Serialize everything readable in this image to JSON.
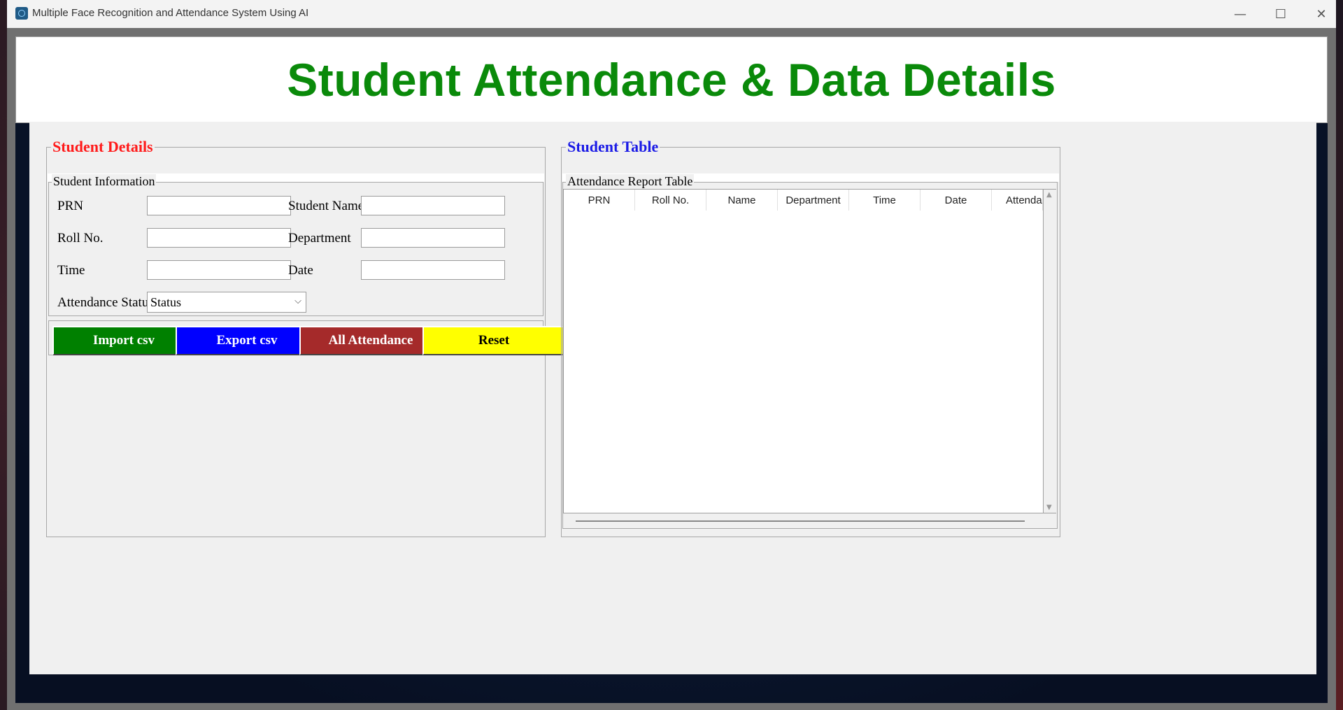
{
  "window": {
    "title": "Multiple Face Recognition and Attendance System Using AI",
    "minimize_glyph": "—",
    "maximize_glyph": "☐",
    "close_glyph": "✕"
  },
  "header": {
    "title": "Student Attendance & Data Details",
    "color": "#0a8a0a"
  },
  "student_details": {
    "frame_title": "Student Details",
    "frame_title_color": "#ff1a1a",
    "info_title": "Student Information",
    "fields": {
      "prn": {
        "label": "PRN",
        "value": ""
      },
      "student_name": {
        "label": "Student Name",
        "value": ""
      },
      "roll_no": {
        "label": "Roll No.",
        "value": ""
      },
      "department": {
        "label": "Department",
        "value": ""
      },
      "time": {
        "label": "Time",
        "value": ""
      },
      "date": {
        "label": "Date",
        "value": ""
      },
      "attendance_status": {
        "label": "Attendance Status",
        "value": "Status"
      }
    },
    "buttons": {
      "import": {
        "label": "Import csv",
        "bg": "#008000",
        "fg": "#ffffff"
      },
      "export": {
        "label": "Export csv",
        "bg": "#0000ff",
        "fg": "#ffffff"
      },
      "all_attendance": {
        "label": "All Attendance",
        "bg": "#a52a2a",
        "fg": "#ffffff"
      },
      "reset": {
        "label": "Reset",
        "bg": "#ffff00",
        "fg": "#000000"
      }
    }
  },
  "student_table": {
    "frame_title": "Student Table",
    "frame_title_color": "#1a1ae6",
    "table_title": "Attendance Report Table",
    "columns": [
      "PRN",
      "Roll No.",
      "Name",
      "Department",
      "Time",
      "Date",
      "Attendanc"
    ],
    "rows": []
  },
  "icons": {
    "app": "app-icon",
    "scroll_up": "▲",
    "scroll_down": "▼",
    "combo_arrow": "⌵"
  }
}
